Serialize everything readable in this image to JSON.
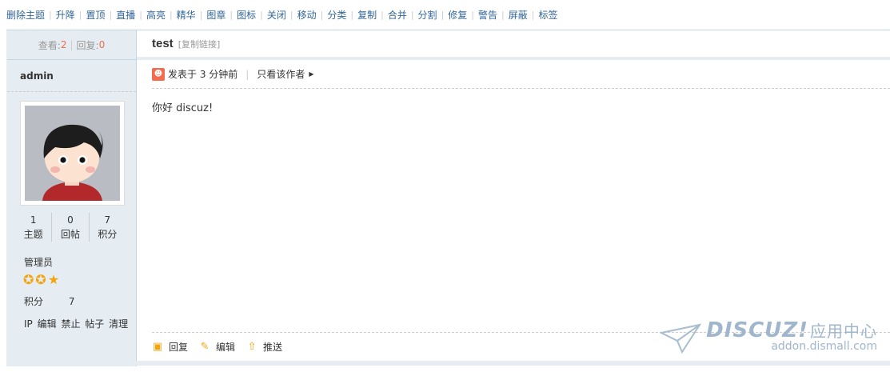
{
  "toolbar": {
    "items": [
      "删除主题",
      "升降",
      "置顶",
      "直播",
      "高亮",
      "精华",
      "图章",
      "图标",
      "关闭",
      "移动",
      "分类",
      "复制",
      "合并",
      "分割",
      "修复",
      "警告",
      "屏蔽",
      "标签"
    ]
  },
  "side": {
    "views_label": "查看:",
    "views": "2",
    "replies_label": "回复:",
    "replies": "0",
    "author": "admin",
    "stats": [
      {
        "value": "1",
        "label": "主题"
      },
      {
        "value": "0",
        "label": "回帖"
      },
      {
        "value": "7",
        "label": "积分"
      }
    ],
    "role": "管理员",
    "credits_label": "积分",
    "credits_value": "7",
    "admin_links": [
      "IP",
      "编辑",
      "禁止",
      "帖子",
      "清理"
    ]
  },
  "main": {
    "title": "test",
    "copy_link": "[复制链接]",
    "posted": "发表于 3 分钟前",
    "only_author": "只看该作者",
    "content": "你好 discuz!"
  },
  "actions": {
    "reply": "回复",
    "edit": "编辑",
    "push": "推送"
  },
  "watermark": {
    "logo": "DISCUZ!",
    "cn": "应用中心",
    "url": "addon.dismall.com"
  },
  "colors": {
    "accent": "#f26c4f",
    "link": "#336699",
    "side_bg": "#e5edf2",
    "border": "#c2d5e3",
    "star": "#f4a30d"
  }
}
